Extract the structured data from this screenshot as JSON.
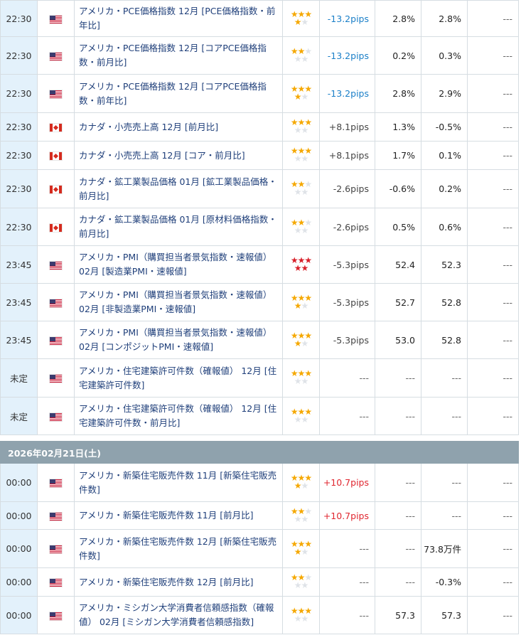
{
  "colors": {
    "time_cell_bg": "#e3f1fb",
    "date_bar_bg": "#8fa2ad",
    "name_text": "#1f3f7a",
    "pips_negative": "#1a7fc8",
    "pips_positive": "#e0262f",
    "star_gold": "#f5a800",
    "star_red": "#d8202a",
    "star_off": "#dfe3e8"
  },
  "rows_day1": [
    {
      "time": "22:30",
      "flag": "us-flag-icon",
      "name": "アメリカ・PCE価格指数 12月 [PCE価格指数・前年比]",
      "stars": 4,
      "star_color": "gold",
      "pips": "-13.2pips",
      "pips_type": "neg",
      "v1": "2.8%",
      "v2": "2.8%",
      "v3": "---",
      "h": 51
    },
    {
      "time": "22:30",
      "flag": "us-flag-icon",
      "name": "アメリカ・PCE価格指数 12月 [コアPCE価格指数・前月比]",
      "stars": 2,
      "star_color": "gold",
      "pips": "-13.2pips",
      "pips_type": "neg",
      "v1": "0.2%",
      "v2": "0.3%",
      "v3": "---",
      "h": 53
    },
    {
      "time": "22:30",
      "flag": "us-flag-icon",
      "name": "アメリカ・PCE価格指数 12月 [コアPCE価格指数・前年比]",
      "stars": 4,
      "star_color": "gold",
      "pips": "-13.2pips",
      "pips_type": "neg",
      "v1": "2.8%",
      "v2": "2.9%",
      "v3": "---",
      "h": 54
    },
    {
      "time": "22:30",
      "flag": "ca-flag-icon",
      "name": "カナダ・小売売上高 12月 [前月比]",
      "stars": 3,
      "star_color": "gold",
      "pips": "+8.1pips",
      "pips_type": "gray",
      "v1": "1.3%",
      "v2": "-0.5%",
      "v3": "---",
      "h": 40
    },
    {
      "time": "22:30",
      "flag": "ca-flag-icon",
      "name": "カナダ・小売売上高 12月 [コア・前月比]",
      "stars": 3,
      "star_color": "gold",
      "pips": "+8.1pips",
      "pips_type": "gray",
      "v1": "1.7%",
      "v2": "0.1%",
      "v3": "---",
      "h": 40
    },
    {
      "time": "22:30",
      "flag": "ca-flag-icon",
      "name": "カナダ・鉱工業製品価格 01月 [鉱工業製品価格・前月比]",
      "stars": 2,
      "star_color": "gold",
      "pips": "-2.6pips",
      "pips_type": "gray",
      "v1": "-0.6%",
      "v2": "0.2%",
      "v3": "---",
      "h": 54
    },
    {
      "time": "22:30",
      "flag": "ca-flag-icon",
      "name": "カナダ・鉱工業製品価格 01月 [原材料価格指数・前月比]",
      "stars": 2,
      "star_color": "gold",
      "pips": "-2.6pips",
      "pips_type": "gray",
      "v1": "0.5%",
      "v2": "0.6%",
      "v3": "---",
      "h": 53
    },
    {
      "time": "23:45",
      "flag": "us-flag-icon",
      "name": "アメリカ・PMI（購買担当者景気指数・速報値） 02月 [製造業PMI・速報値]",
      "stars": 5,
      "star_color": "red",
      "pips": "-5.3pips",
      "pips_type": "gray",
      "v1": "52.4",
      "v2": "52.3",
      "v3": "---",
      "h": 53
    },
    {
      "time": "23:45",
      "flag": "us-flag-icon",
      "name": "アメリカ・PMI（購買担当者景気指数・速報値） 02月 [非製造業PMI・速報値]",
      "stars": 4,
      "star_color": "gold",
      "pips": "-5.3pips",
      "pips_type": "gray",
      "v1": "52.7",
      "v2": "52.8",
      "v3": "---",
      "h": 53
    },
    {
      "time": "23:45",
      "flag": "us-flag-icon",
      "name": "アメリカ・PMI（購買担当者景気指数・速報値） 02月 [コンポジットPMI・速報値]",
      "stars": 4,
      "star_color": "gold",
      "pips": "-5.3pips",
      "pips_type": "gray",
      "v1": "53.0",
      "v2": "52.8",
      "v3": "---",
      "h": 53
    },
    {
      "time": "未定",
      "flag": "us-flag-icon",
      "name": "アメリカ・住宅建築許可件数（確報値） 12月 [住宅建築許可件数]",
      "stars": 3,
      "star_color": "gold",
      "pips": "---",
      "pips_type": "dash",
      "v1": "---",
      "v2": "---",
      "v3": "---",
      "h": 54
    },
    {
      "time": "未定",
      "flag": "us-flag-icon",
      "name": "アメリカ・住宅建築許可件数（確報値） 12月 [住宅建築許可件数・前月比]",
      "stars": 3,
      "star_color": "gold",
      "pips": "---",
      "pips_type": "dash",
      "v1": "---",
      "v2": "---",
      "v3": "---",
      "h": 53
    }
  ],
  "date_header": "2026年02月21日(土)",
  "rows_day2": [
    {
      "time": "00:00",
      "flag": "us-flag-icon",
      "name": "アメリカ・新築住宅販売件数 11月 [新築住宅販売件数]",
      "stars": 4,
      "star_color": "gold",
      "pips": "+10.7pips",
      "pips_type": "pos",
      "v1": "---",
      "v2": "---",
      "v3": "---",
      "h": 54
    },
    {
      "time": "00:00",
      "flag": "us-flag-icon",
      "name": "アメリカ・新築住宅販売件数 11月 [前月比]",
      "stars": 2,
      "star_color": "gold",
      "pips": "+10.7pips",
      "pips_type": "pos",
      "v1": "---",
      "v2": "---",
      "v3": "---",
      "h": 39
    },
    {
      "time": "00:00",
      "flag": "us-flag-icon",
      "name": "アメリカ・新築住宅販売件数 12月 [新築住宅販売件数]",
      "stars": 4,
      "star_color": "gold",
      "pips": "---",
      "pips_type": "dash",
      "v1": "---",
      "v2": "73.8万件",
      "v3": "---",
      "h": 54
    },
    {
      "time": "00:00",
      "flag": "us-flag-icon",
      "name": "アメリカ・新築住宅販売件数 12月 [前月比]",
      "stars": 2,
      "star_color": "gold",
      "pips": "---",
      "pips_type": "dash",
      "v1": "---",
      "v2": "-0.3%",
      "v3": "---",
      "h": 40
    },
    {
      "time": "00:00",
      "flag": "us-flag-icon",
      "name": "アメリカ・ミシガン大学消費者信頼感指数（確報値） 02月 [ミシガン大学消費者信頼感指数]",
      "stars": 3,
      "star_color": "gold",
      "pips": "---",
      "pips_type": "dash",
      "v1": "57.3",
      "v2": "57.3",
      "v3": "---",
      "h": 53
    }
  ]
}
